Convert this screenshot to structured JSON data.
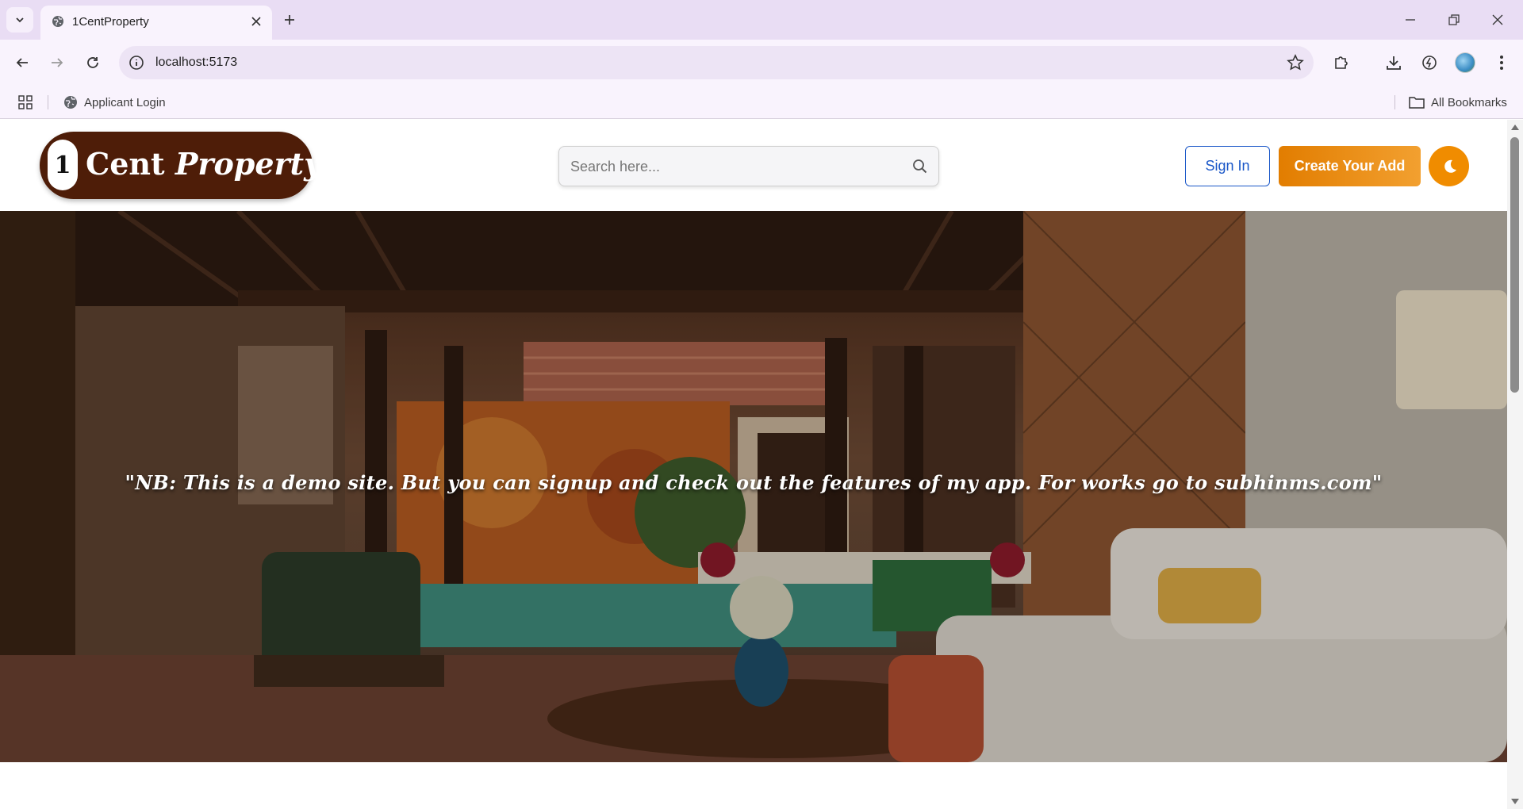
{
  "browser": {
    "tab_title": "1CentProperty",
    "url": "localhost:5173",
    "bookmarks": [
      {
        "label": "Applicant Login",
        "icon": "globe-icon"
      }
    ],
    "all_bookmarks_label": "All Bookmarks"
  },
  "header": {
    "logo": {
      "one": "1",
      "cent": "Cent",
      "property": "Property"
    },
    "search_placeholder": "Search here...",
    "signin_label": "Sign In",
    "create_label": "Create Your Add",
    "theme_icon": "moon-icon"
  },
  "hero": {
    "caption": "\"NB: This is a demo site. But you can signup and check out the features of my app. For works go to subhinms.com\""
  },
  "colors": {
    "logo_bg": "#4e1d08",
    "signin_border": "#1a57c8",
    "create_bg": "#e27d00",
    "theme_bg": "#f08c00"
  }
}
